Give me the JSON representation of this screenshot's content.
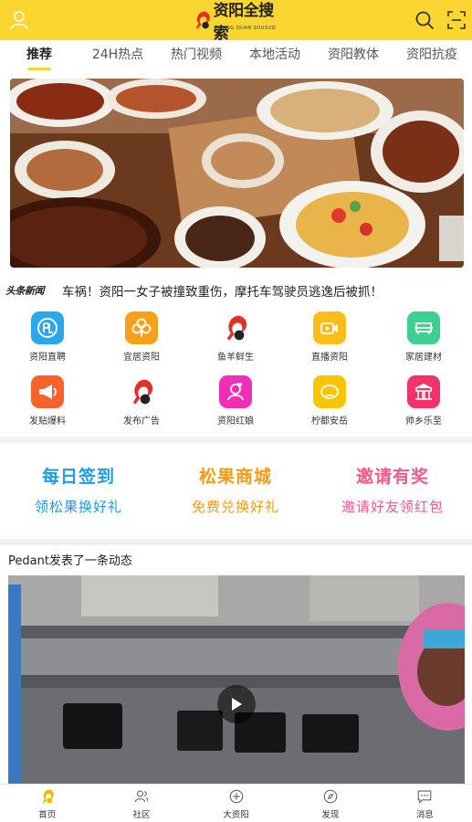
{
  "header": {
    "brand": "资阳全搜索",
    "brand_sub": "ZIYANG QUAN SOUSUO"
  },
  "tabs": [
    {
      "label": "推荐",
      "active": true
    },
    {
      "label": "24H热点"
    },
    {
      "label": "热门视频"
    },
    {
      "label": "本地活动"
    },
    {
      "label": "资阳教体"
    },
    {
      "label": "资阳抗疫"
    }
  ],
  "headline": {
    "source_logo": "头条新闻",
    "text": "车祸！资阳一女子被撞致重伤，摩托车驾驶员逃逸后被抓！"
  },
  "grid": [
    {
      "label": "资阳直聘",
      "icon": "recruit-icon",
      "color": "#2aa7ef"
    },
    {
      "label": "宜居资阳",
      "icon": "clover-icon",
      "color": "#f7a11a"
    },
    {
      "label": "鱼羊鲜生",
      "icon": "squirrel-icon",
      "color": "#ffffff"
    },
    {
      "label": "直播资阳",
      "icon": "video-camera-icon",
      "color": "#fbbd18"
    },
    {
      "label": "家居建材",
      "icon": "sofa-icon",
      "color": "#3fcf8e"
    },
    {
      "label": "发贴爆料",
      "icon": "megaphone-icon",
      "color": "#f8622b"
    },
    {
      "label": "发布广告",
      "icon": "squirrel-icon",
      "color": "#ffffff"
    },
    {
      "label": "资阳红娘",
      "icon": "heart-person-icon",
      "color": "#ef2fb8"
    },
    {
      "label": "柠都安岳",
      "icon": "lemon-icon",
      "color": "#f9c400"
    },
    {
      "label": "帅乡乐至",
      "icon": "pavilion-icon",
      "color": "#f4326a"
    }
  ],
  "promos": [
    {
      "title": "每日签到",
      "subtitle": "领松果换好礼",
      "color": "#1e9be8"
    },
    {
      "title": "松果商城",
      "subtitle": "免费兑换好礼",
      "color": "#f59a12"
    },
    {
      "title": "邀请有奖",
      "subtitle": "邀请好友领红包",
      "color": "#ef5b8a"
    }
  ],
  "post": {
    "title": "Pedant发表了一条动态"
  },
  "bottom_nav": [
    {
      "label": "首页",
      "icon": "home-squirrel-icon",
      "active": true
    },
    {
      "label": "社区",
      "icon": "community-icon"
    },
    {
      "label": "大资阳",
      "icon": "plus-circle-icon"
    },
    {
      "label": "发现",
      "icon": "discover-icon"
    },
    {
      "label": "消息",
      "icon": "message-icon"
    }
  ],
  "colors": {
    "accent": "#fcd630",
    "text": "#222222"
  }
}
